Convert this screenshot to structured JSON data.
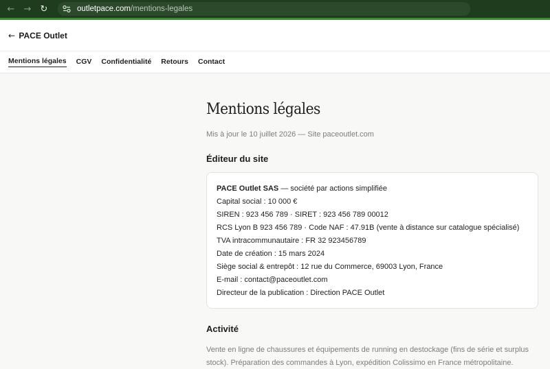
{
  "browser": {
    "url_domain": "outletpace.com",
    "url_path": "/mentions-legales",
    "back_icon": "arrow-left-icon",
    "forward_icon": "arrow-right-icon",
    "reload_icon": "reload-icon",
    "site_info_icon": "tune-icon"
  },
  "header": {
    "back_arrow": "←",
    "back_label": "PACE Outlet"
  },
  "tabs": [
    {
      "label": "Mentions légales",
      "active": true
    },
    {
      "label": "CGV",
      "active": false
    },
    {
      "label": "Confidentialité",
      "active": false
    },
    {
      "label": "Retours",
      "active": false
    },
    {
      "label": "Contact",
      "active": false
    }
  ],
  "page": {
    "title": "Mentions légales",
    "updated": "Mis à jour le 10 juillet 2026 — Site paceoutlet.com"
  },
  "editor": {
    "heading": "Éditeur du site",
    "company_name": "PACE Outlet SAS",
    "company_desc": " — société par actions simplifiée",
    "lines": [
      "Capital social : 10 000 €",
      "SIREN : 923 456 789 · SIRET : 923 456 789 00012",
      "RCS Lyon B 923 456 789 · Code NAF : 47.91B (vente à distance sur catalogue spécialisé)",
      "TVA intracommunautaire : FR 32 923456789",
      "Date de création : 15 mars 2024",
      "Siège social & entrepôt : 12 rue du Commerce, 69003 Lyon, France",
      "E-mail : contact@paceoutlet.com",
      "Directeur de la publication : Direction PACE Outlet"
    ]
  },
  "activity": {
    "heading": "Activité",
    "text": "Vente en ligne de chaussures et équipements de running en destockage (fins de série et surplus stock). Préparation des commandes à Lyon, expédition Colissimo en France métropolitaine."
  },
  "colors": {
    "browser_bg": "#1f3d1e",
    "browser_accent": "#3d8a39",
    "page_bg": "#f8f8f7",
    "muted_text": "#7d7d7a"
  }
}
